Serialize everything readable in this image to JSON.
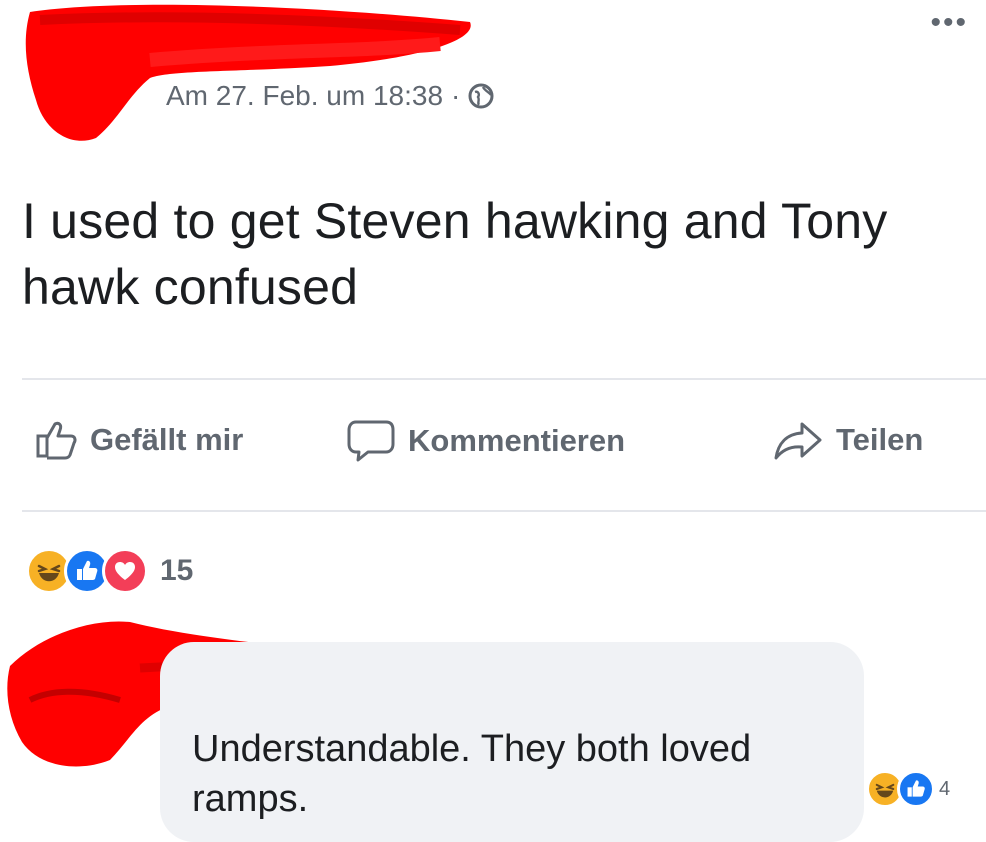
{
  "post": {
    "timestamp": "Am 27. Feb. um 18:38",
    "separator": "·",
    "more_label": "•••",
    "text": "I used to get Steven hawking and Tony hawk confused"
  },
  "actions": {
    "like_label": "Gefällt mir",
    "comment_label": "Kommentieren",
    "share_label": "Teilen"
  },
  "reactions": {
    "types": [
      "haha-icon",
      "like-icon",
      "love-icon"
    ],
    "count": "15"
  },
  "comment": {
    "text": "Understandable. They both loved ramps.",
    "reaction_types": [
      "haha-icon",
      "like-icon"
    ],
    "reaction_count": "4"
  },
  "colors": {
    "redaction": "#ff0000",
    "like_blue": "#1877f2",
    "love_red": "#f33e58",
    "haha_yellow": "#f7b125",
    "secondary_text": "#606770",
    "bubble_bg": "#f0f2f5"
  }
}
